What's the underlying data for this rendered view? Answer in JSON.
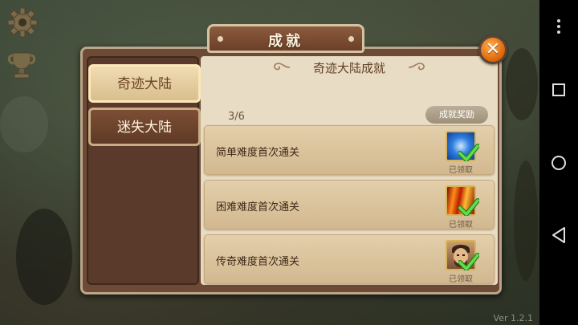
{
  "window": {
    "title": "成就",
    "version": "Ver 1.2.1"
  },
  "sidebar": {
    "tabs": [
      {
        "label": "奇迹大陆",
        "active": true
      },
      {
        "label": "迷失大陆",
        "active": false
      }
    ]
  },
  "content": {
    "title": "奇迹大陆成就",
    "progress": "3/6",
    "reward_header": "成就奖励",
    "achievements": [
      {
        "label": "简单难度首次通关",
        "status": "已领取",
        "reward_icon": "blue-orb-icon"
      },
      {
        "label": "困难难度首次通关",
        "status": "已领取",
        "reward_icon": "fire-claw-icon"
      },
      {
        "label": "传奇难度首次通关",
        "status": "已领取",
        "reward_icon": "hero-portrait-icon"
      }
    ]
  },
  "colors": {
    "accent": "#e36d10",
    "panel": "#6c4a36",
    "check": "#4fd13a"
  }
}
